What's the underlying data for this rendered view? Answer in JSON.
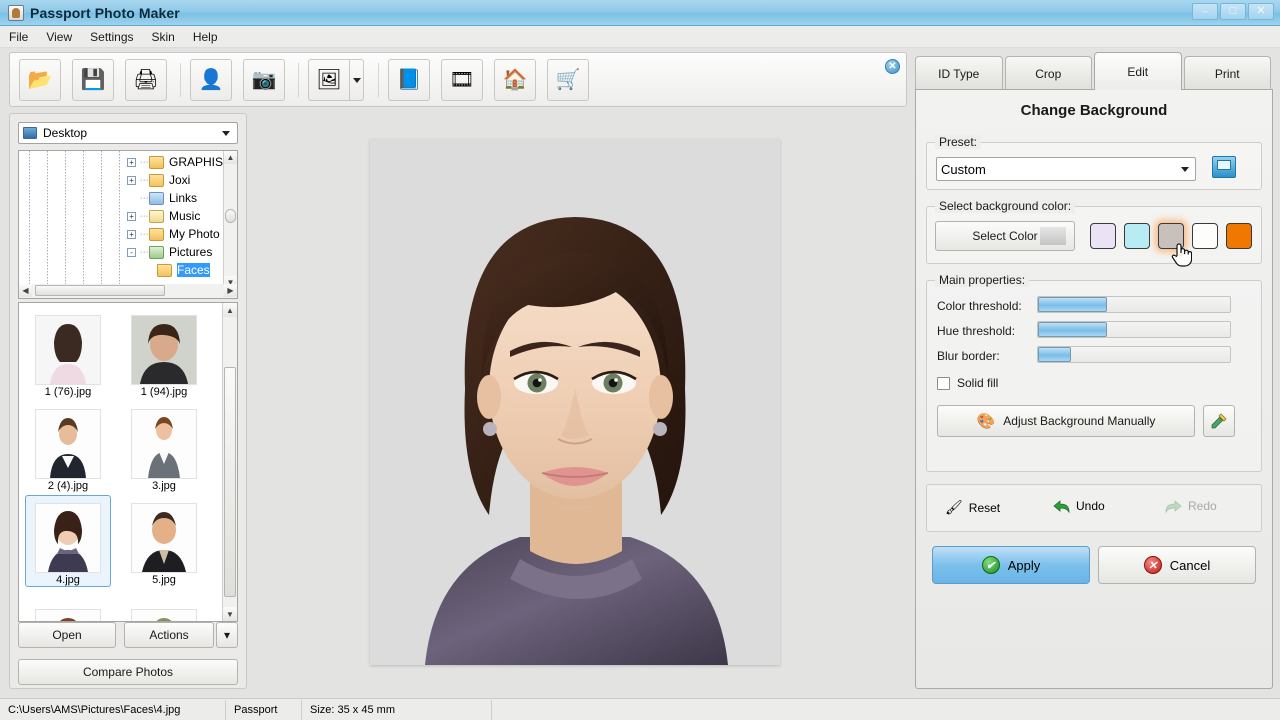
{
  "window": {
    "title": "Passport Photo Maker",
    "icon": "app-icon",
    "controls": {
      "minimize": "–",
      "maximize": "□",
      "close": "✕"
    }
  },
  "menu": {
    "items": [
      "File",
      "View",
      "Settings",
      "Skin",
      "Help"
    ]
  },
  "toolbar": {
    "buttons": [
      {
        "name": "open-photo-button",
        "icon": "📂",
        "glyph": "open-folder-icon"
      },
      {
        "name": "save-button",
        "icon": "💾",
        "glyph": "floppy-disk-icon"
      },
      {
        "name": "print-button",
        "icon": "🖨",
        "glyph": "printer-icon"
      },
      {
        "name": "find-person-button",
        "icon": "👤",
        "glyph": "person-search-icon"
      },
      {
        "name": "camera-button",
        "icon": "📷",
        "glyph": "camera-icon"
      },
      {
        "name": "image-search-button",
        "icon": "🖼",
        "glyph": "image-search-icon"
      },
      {
        "name": "help-book-button",
        "icon": "📘",
        "glyph": "help-book-icon"
      },
      {
        "name": "video-tutorial-button",
        "icon": "🎞",
        "glyph": "film-reel-icon"
      },
      {
        "name": "home-button",
        "icon": "🏠",
        "glyph": "home-icon"
      },
      {
        "name": "buy-now-button",
        "icon": "🛒",
        "glyph": "shopping-cart-icon"
      }
    ],
    "close_label": "✕"
  },
  "sidebar": {
    "location": {
      "label": "Desktop",
      "icon": "desktop-icon"
    },
    "tree": [
      {
        "label": "GRAPHIS",
        "expander": "+",
        "kind": "folder"
      },
      {
        "label": "Joxi",
        "expander": "+",
        "kind": "folder"
      },
      {
        "label": "Links",
        "expander": "",
        "kind": "blue"
      },
      {
        "label": "Music",
        "expander": "+",
        "kind": "note"
      },
      {
        "label": "My Photo",
        "expander": "+",
        "kind": "folder"
      },
      {
        "label": "Pictures",
        "expander": "-",
        "kind": "img"
      },
      {
        "label": "Faces",
        "expander": "",
        "kind": "folder"
      }
    ],
    "thumbnails": [
      {
        "caption": "1 (76).jpg",
        "selected": false
      },
      {
        "caption": "1 (94).jpg",
        "selected": false
      },
      {
        "caption": "2 (4).jpg",
        "selected": false
      },
      {
        "caption": "3.jpg",
        "selected": false
      },
      {
        "caption": "4.jpg",
        "selected": true
      },
      {
        "caption": "5.jpg",
        "selected": false
      },
      {
        "caption": "",
        "selected": false
      },
      {
        "caption": "",
        "selected": false
      }
    ],
    "buttons": {
      "open": "Open",
      "actions": "Actions",
      "actions_caret": "▾",
      "compare": "Compare Photos"
    }
  },
  "tabs": [
    {
      "label": "ID Type",
      "active": false
    },
    {
      "label": "Crop",
      "active": false
    },
    {
      "label": "Edit",
      "active": true
    },
    {
      "label": "Print",
      "active": false
    }
  ],
  "edit_panel": {
    "title": "Change Background",
    "preset": {
      "group_label": "Preset:",
      "value": "Custom",
      "save_icon": "save-preset-icon"
    },
    "background_color": {
      "group_label": "Select background color:",
      "select_color_label": "Select Color",
      "current_color": "#cfcfcf",
      "swatches": [
        "#ece2f5",
        "#b8ecf5",
        "#c8c0bc",
        "#fdfdfb",
        "#f07800"
      ]
    },
    "main_properties": {
      "group_label": "Main properties:",
      "sliders": [
        {
          "label": "Color threshold:",
          "percent": 36
        },
        {
          "label": "Hue threshold:",
          "percent": 36
        },
        {
          "label": "Blur border:",
          "percent": 17
        }
      ],
      "solid_fill": {
        "label": "Solid fill",
        "checked": false
      },
      "adjust_manually": {
        "label": "Adjust Background Manually",
        "icon": "palette-icon"
      },
      "eyedropper": {
        "icon": "eyedropper-icon"
      }
    },
    "history": [
      {
        "label": "Reset",
        "icon": "brush-icon",
        "enabled": true
      },
      {
        "label": "Undo",
        "icon": "undo-arrow-icon",
        "enabled": true
      },
      {
        "label": "Redo",
        "icon": "redo-arrow-icon",
        "enabled": false
      }
    ],
    "actions": {
      "apply": {
        "label": "Apply",
        "icon": "check-circle-icon"
      },
      "cancel": {
        "label": "Cancel",
        "icon": "cancel-circle-icon"
      }
    }
  },
  "statusbar": {
    "path": "C:\\Users\\AMS\\Pictures\\Faces\\4.jpg",
    "doc_type": "Passport",
    "size": "Size: 35 x 45 mm"
  },
  "colors": {
    "title_bar": "#8fc9e8",
    "panel_bg": "#eeeeec",
    "workspace_bg": "#e3e3e1",
    "photo_bg": "#dcdcdc",
    "accent": "#7cc0ec"
  }
}
